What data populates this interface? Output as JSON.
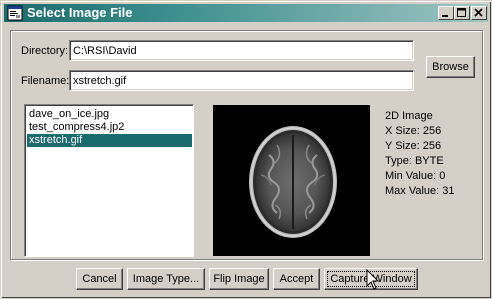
{
  "window": {
    "title": "Select Image File",
    "icons": [
      "app-icon",
      "minimize-icon",
      "maximize-icon",
      "close-icon"
    ]
  },
  "form": {
    "directory_label": "Directory:",
    "directory_value": "C:\\RSI\\David",
    "filename_label": "Filename:",
    "filename_value": "xstretch.gif",
    "browse_label": "Browse"
  },
  "file_list": {
    "items": [
      "dave_on_ice.jpg",
      "test_compress4.jp2",
      "xstretch.gif"
    ],
    "selected_index": 2
  },
  "preview": {
    "description_icon": "brain-mri-axial-slice"
  },
  "image_info": {
    "kind": "2D Image",
    "x_size": "X Size: 256",
    "y_size": "Y Size: 256",
    "type": "Type: BYTE",
    "min_value": "Min Value: 0",
    "max_value": "Max Value: 31"
  },
  "buttons": {
    "cancel": "Cancel",
    "image_type": "Image Type...",
    "flip_image": "Flip Image",
    "accept": "Accept",
    "capture_window": "Capture Window"
  },
  "colors": {
    "title_start": "#1b6a6d",
    "title_end": "#9fc5c3",
    "selection": "#1b6a6d",
    "face": "#d4d0c8"
  }
}
